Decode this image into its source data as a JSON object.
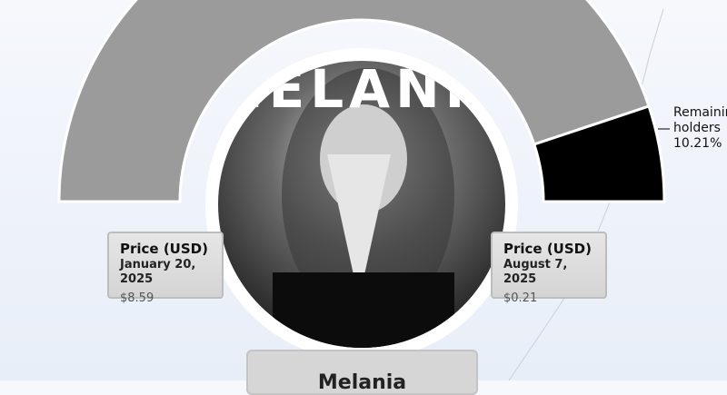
{
  "chart_data": {
    "type": "pie",
    "slices": [
      {
        "label": "",
        "value": 89.79,
        "color": "#9b9b9b"
      },
      {
        "label": "Remaining holders",
        "value": 10.21,
        "color": "#000000",
        "value_text": "10.21%"
      }
    ]
  },
  "logo_text": "MELANIA",
  "cards": {
    "left": {
      "title": "Price (USD)",
      "date": "January 20, 2025",
      "price": "$8.59"
    },
    "right": {
      "title": "Price (USD)",
      "date": "August 7, 2025",
      "price": "$0.21"
    }
  },
  "bottom_label": "Melania",
  "colors": {
    "gray_slice": "#9b9b9b",
    "black_slice": "#000000",
    "background": "#f3f6fb"
  }
}
